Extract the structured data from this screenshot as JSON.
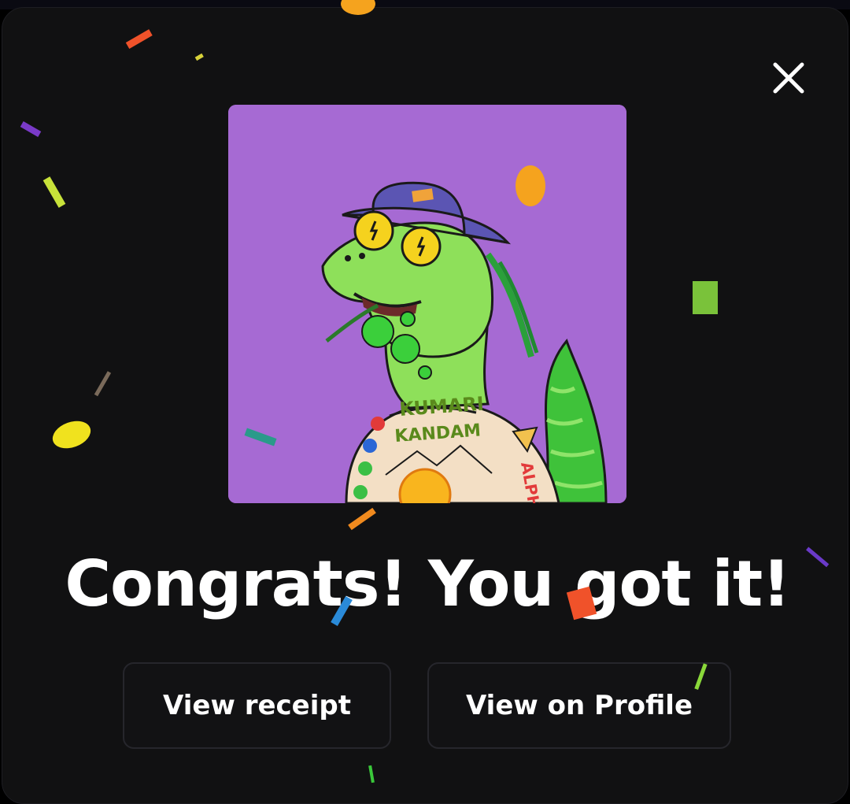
{
  "modal": {
    "close_icon": "close-icon",
    "artwork": {
      "background_color": "#a66ad3",
      "sweater_text_line1": "KUMARI",
      "sweater_text_line2": "KANDAM",
      "sleeve_text": "ALPH"
    },
    "headline": "Congrats! You got it!",
    "buttons": {
      "receipt_label": "View receipt",
      "profile_label": "View on Profile"
    }
  },
  "colors": {
    "modal_bg": "#111112",
    "button_bg": "#121214",
    "button_border": "#26262c",
    "text": "#ffffff"
  }
}
